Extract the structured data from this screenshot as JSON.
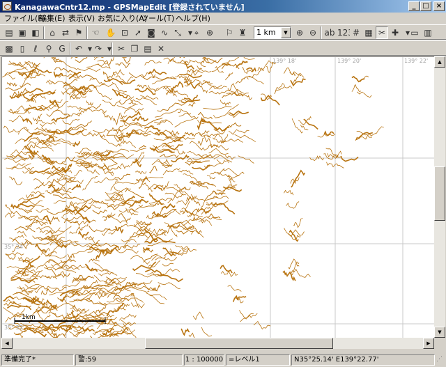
{
  "window": {
    "title": "KanagawaCntr12.mp - GPSMapEdit [登録されていません]"
  },
  "menu": [
    {
      "label": "ファイル(F)"
    },
    {
      "label": "編集(E)"
    },
    {
      "label": "表示(V)"
    },
    {
      "label": "お気に入り(A)"
    },
    {
      "label": "ツール(T)"
    },
    {
      "label": "ヘルプ(H)"
    }
  ],
  "toolbar": {
    "scale_value": "1 km"
  },
  "map": {
    "lon_labels": [
      "139° 18'",
      "139° 20'",
      "139° 22'"
    ],
    "lat_labels": [
      "35° 24'",
      "35° 22'"
    ],
    "scale_bar_label": "1km",
    "colors": {
      "contour": "#b8730f",
      "grid": "#c8c8c8",
      "background": "#ffffff"
    }
  },
  "status": {
    "ready": "準備完了*",
    "warnings": "警:59",
    "scale": "1 : 100000",
    "level": "=レベル1",
    "coords": "N35°25.14' E139°22.77'"
  }
}
